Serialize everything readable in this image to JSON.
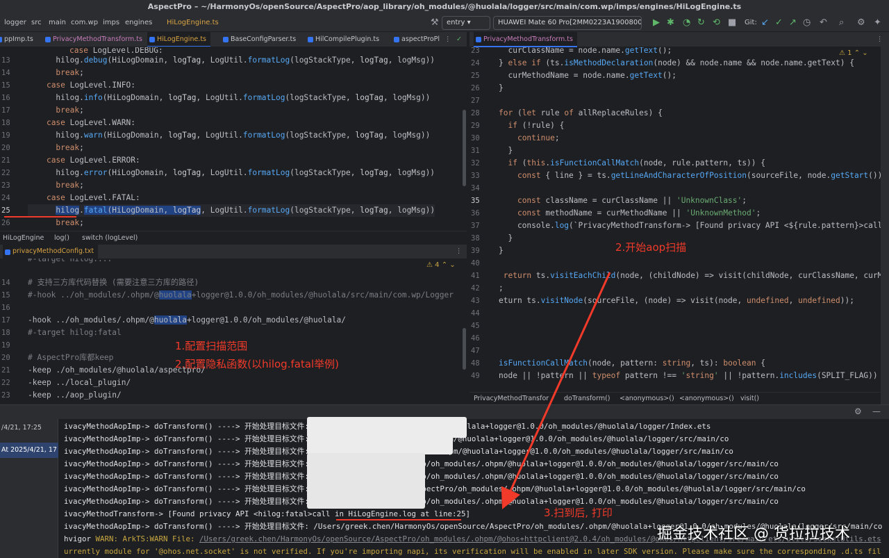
{
  "title": "AspectPro – ~/HarmonyOs/openSource/AspectPro/aop_library/oh_modules/@huolala/logger/src/main/com.wp/imps/engines/HiLogEngine.ts",
  "toolbar": {
    "breadcrumb": [
      "logger",
      "src",
      "main",
      "com.wp",
      "imps",
      "engines",
      "HiLogEngine.ts"
    ],
    "run_config": "entry",
    "device": "HUAWEI Mate 60 Pro[2MM0223A19008006]",
    "git_label": "Git:"
  },
  "left_tabs": [
    "ppImp.ts",
    "PrivacyMethodTransform.ts",
    "HiLogEngine.ts",
    "BaseConfigParser.ts",
    "HilCompilePlugin.ts",
    "aspectProPl"
  ],
  "right_tabs": [
    "PrivacyMethodTransform.ts"
  ],
  "left_code": [
    {
      "n": "13",
      "code": "      hilog.debug(HiLogDomain, logTag, LogUtil.formatLog(logStackType, logTag, logMsg))"
    },
    {
      "n": "14",
      "code": "      break;"
    },
    {
      "n": "15",
      "code": "    case LogLevel.INFO:"
    },
    {
      "n": "16",
      "code": "      hilog.info(HiLogDomain, logTag, LogUtil.formatLog(logStackType, logTag, logMsg))"
    },
    {
      "n": "17",
      "code": "      break;"
    },
    {
      "n": "18",
      "code": "    case LogLevel.WARN:"
    },
    {
      "n": "19",
      "code": "      hilog.warn(HiLogDomain, logTag, LogUtil.formatLog(logStackType, logTag, logMsg))"
    },
    {
      "n": "20",
      "code": "      break;"
    },
    {
      "n": "21",
      "code": "    case LogLevel.ERROR:"
    },
    {
      "n": "22",
      "code": "      hilog.error(HiLogDomain, logTag, LogUtil.formatLog(logStackType, logTag, logMsg))"
    },
    {
      "n": "23",
      "code": "      break;"
    },
    {
      "n": "24",
      "code": "    case LogLevel.FATAL:"
    },
    {
      "n": "25",
      "code": "      hilog.fatal(HiLogDomain, logTag, LogUtil.formatLog(logStackType, logTag, logMsg))"
    },
    {
      "n": "26",
      "code": "      break;"
    }
  ],
  "left_crumbs": [
    "HiLogEngine",
    "log()",
    "switch (logLevel)"
  ],
  "config_tab": "privacyMethodConfig.txt",
  "config_warn_count": "4",
  "config_code": [
    {
      "n": "14",
      "code": "# 支持三方库代码替换 (需要注意三方库的路径)"
    },
    {
      "n": "15",
      "code": "#-hook ../oh_modules/.ohpm/@huolala+logger@1.0.0/oh_modules/@huolala/src/main/com.wp/Logger"
    },
    {
      "n": "16",
      "code": ""
    },
    {
      "n": "17",
      "code": "-hook ../oh_modules/.ohpm/@huolala+logger@1.0.0/oh_modules/@huolala/"
    },
    {
      "n": "18",
      "code": "#-target hilog:fatal"
    },
    {
      "n": "19",
      "code": ""
    },
    {
      "n": "20",
      "code": "# AspectPro库都keep"
    },
    {
      "n": "21",
      "code": "-keep ./oh_modules/@huolala/aspectpro/"
    },
    {
      "n": "22",
      "code": "-keep ../local_plugin/"
    },
    {
      "n": "23",
      "code": "-keep ../aop_plugin/"
    }
  ],
  "right_code": [
    {
      "n": "23",
      "code": "  curClassName = node.name.getText();"
    },
    {
      "n": "24",
      "code": "} else if (ts.isMethodDeclaration(node) && node.name && node.name.getText) {"
    },
    {
      "n": "25",
      "code": "  curMethodName = node.name.getText();"
    },
    {
      "n": "26",
      "code": "}"
    },
    {
      "n": "27",
      "code": ""
    },
    {
      "n": "28",
      "code": "for (let rule of allReplaceRules) {"
    },
    {
      "n": "29",
      "code": "  if (!rule) {"
    },
    {
      "n": "30",
      "code": "    continue;"
    },
    {
      "n": "31",
      "code": "  }"
    },
    {
      "n": "32",
      "code": "  if (this.isFunctionCallMatch(node, rule.pattern, ts)) {"
    },
    {
      "n": "33",
      "code": "    const { line } = ts.getLineAndCharacterOfPosition(sourceFile, node.getStart());"
    },
    {
      "n": "34",
      "code": ""
    },
    {
      "n": "35",
      "code": "    const className = curClassName || 'UnknownClass';"
    },
    {
      "n": "36",
      "code": "    const methodName = curMethodName || 'UnknownMethod';"
    },
    {
      "n": "37",
      "code": "    console.log(`PrivacyMethodTransform-> [Found privacy API <${rule.pattern}>call in"
    },
    {
      "n": "38",
      "code": "  }"
    },
    {
      "n": "39",
      "code": "}"
    },
    {
      "n": "40",
      "code": ""
    },
    {
      "n": "41",
      "code": " return ts.visitEachChild(node, (childNode) => visit(childNode, curClassName, curMetho"
    },
    {
      "n": "42",
      "code": ";"
    },
    {
      "n": "43",
      "code": "eturn ts.visitNode(sourceFile, (node) => visit(node, undefined, undefined));"
    },
    {
      "n": "44",
      "code": ""
    },
    {
      "n": "45",
      "code": ""
    },
    {
      "n": "46",
      "code": ""
    },
    {
      "n": "47",
      "code": ""
    },
    {
      "n": "48",
      "code": "isFunctionCallMatch(node, pattern: string, ts): boolean {"
    },
    {
      "n": "49",
      "code": "node || !pattern || typeof pattern !== 'string' || !pattern.includes(SPLIT_FLAG)) {"
    }
  ],
  "right_warn_count": "1",
  "right_crumbs": [
    "PrivacyMethodTransfor",
    "doTransform()",
    "<anonymous>()",
    "<anonymous>()",
    "visit()"
  ],
  "run_list": [
    "/4/21, 17:25",
    "At 2025/4/21, 17"
  ],
  "console": [
    "ivacyMethodAopImp-> doTransform() ----> 开始处理目标文件: ...AspectPro/oh_modules/.ohpm/@huolala+logger@1.0.0/oh_modules/@huolala/logger/Index.ets",
    "ivacyMethodAopImp-> doTransform() ----> 开始处理目标文件: ...e/AspectPro/oh_modules/.ohpm/@huolala+logger@1.0.0/oh_modules/@huolala/logger/src/main/co",
    "ivacyMethodAopImp-> doTransform() ----> 开始处理目标文件: ...ce/AspectPro/oh_modules/.ohpm/@huolala+logger@1.0.0/oh_modules/@huolala/logger/src/main/co",
    "ivacyMethodAopImp-> doTransform() ----> 开始处理目标文件: ...s/openSource/AspectPro/oh_modules/.ohpm/@huolala+logger@1.0.0/oh_modules/@huolala/logger/src/main/co",
    "ivacyMethodAopImp-> doTransform() ----> 开始处理目标文件: ...s/openSource/AspectPro/oh_modules/.ohpm/@huolala+logger@1.0.0/oh_modules/@huolala/logger/src/main/co",
    "ivacyMethodAopImp-> doTransform() ----> 开始处理目标文件: ...rmonyOs/openSource/AspectPro/oh_modules/.ohpm/@huolala+logger@1.0.0/oh_modules/@huolala/logger/src/main/co",
    "ivacyMethodAopImp-> doTransform() ----> 开始处理目标文件: ...s/openSource/AspectPro/oh_modules/.ohpm/@huolala+logger@1.0.0/oh_modules/@huolala/logger/src/main/co",
    "ivacyMethodTransform-> [Found privacy API <hilog:fatal>call in HiLogEngine.log at line:25]",
    "ivacyMethodAopImp-> doTransform() ----> 开始处理目标文件: /Users/greek.chen/HarmonyOs/openSource/AspectPro/oh_modules/.ohpm/@huolala+logger@1.0.0/oh_modules/@huolala/logger/src/main/co"
  ],
  "hvigor_warn": {
    "prefix": "hvigor ",
    "label": "WARN: ArkTS:WARN File: ",
    "path": "/Users/greek.chen/HarmonyOs/openSource/AspectPro/oh_modules/.ohpm/@ohos+httpclient@2.0.4/oh_modules/@ohos/httpclient/src/main/ets/utils/SocketUtils.ets",
    "line2": "urrently module for '@ohos.net.socket' is not verified. If you're importing napi, its verification will be enabled in later SDK version. Please make sure the corresponding .d.ts fil"
  },
  "annotations": {
    "config_scope": "1.配置扫描范围",
    "config_fn": "2.配置隐私函数(以hilog.fatal举例)",
    "start_scan": "2.开始aop扫描",
    "scanned": "3.扫到后, 打印"
  },
  "watermark": "掘金技术社区 @ 货拉拉技术",
  "colors": {
    "accent": "#3574f0",
    "annotation": "#f23a2a",
    "bg": "#1e1f22",
    "panel": "#2b2d30"
  }
}
